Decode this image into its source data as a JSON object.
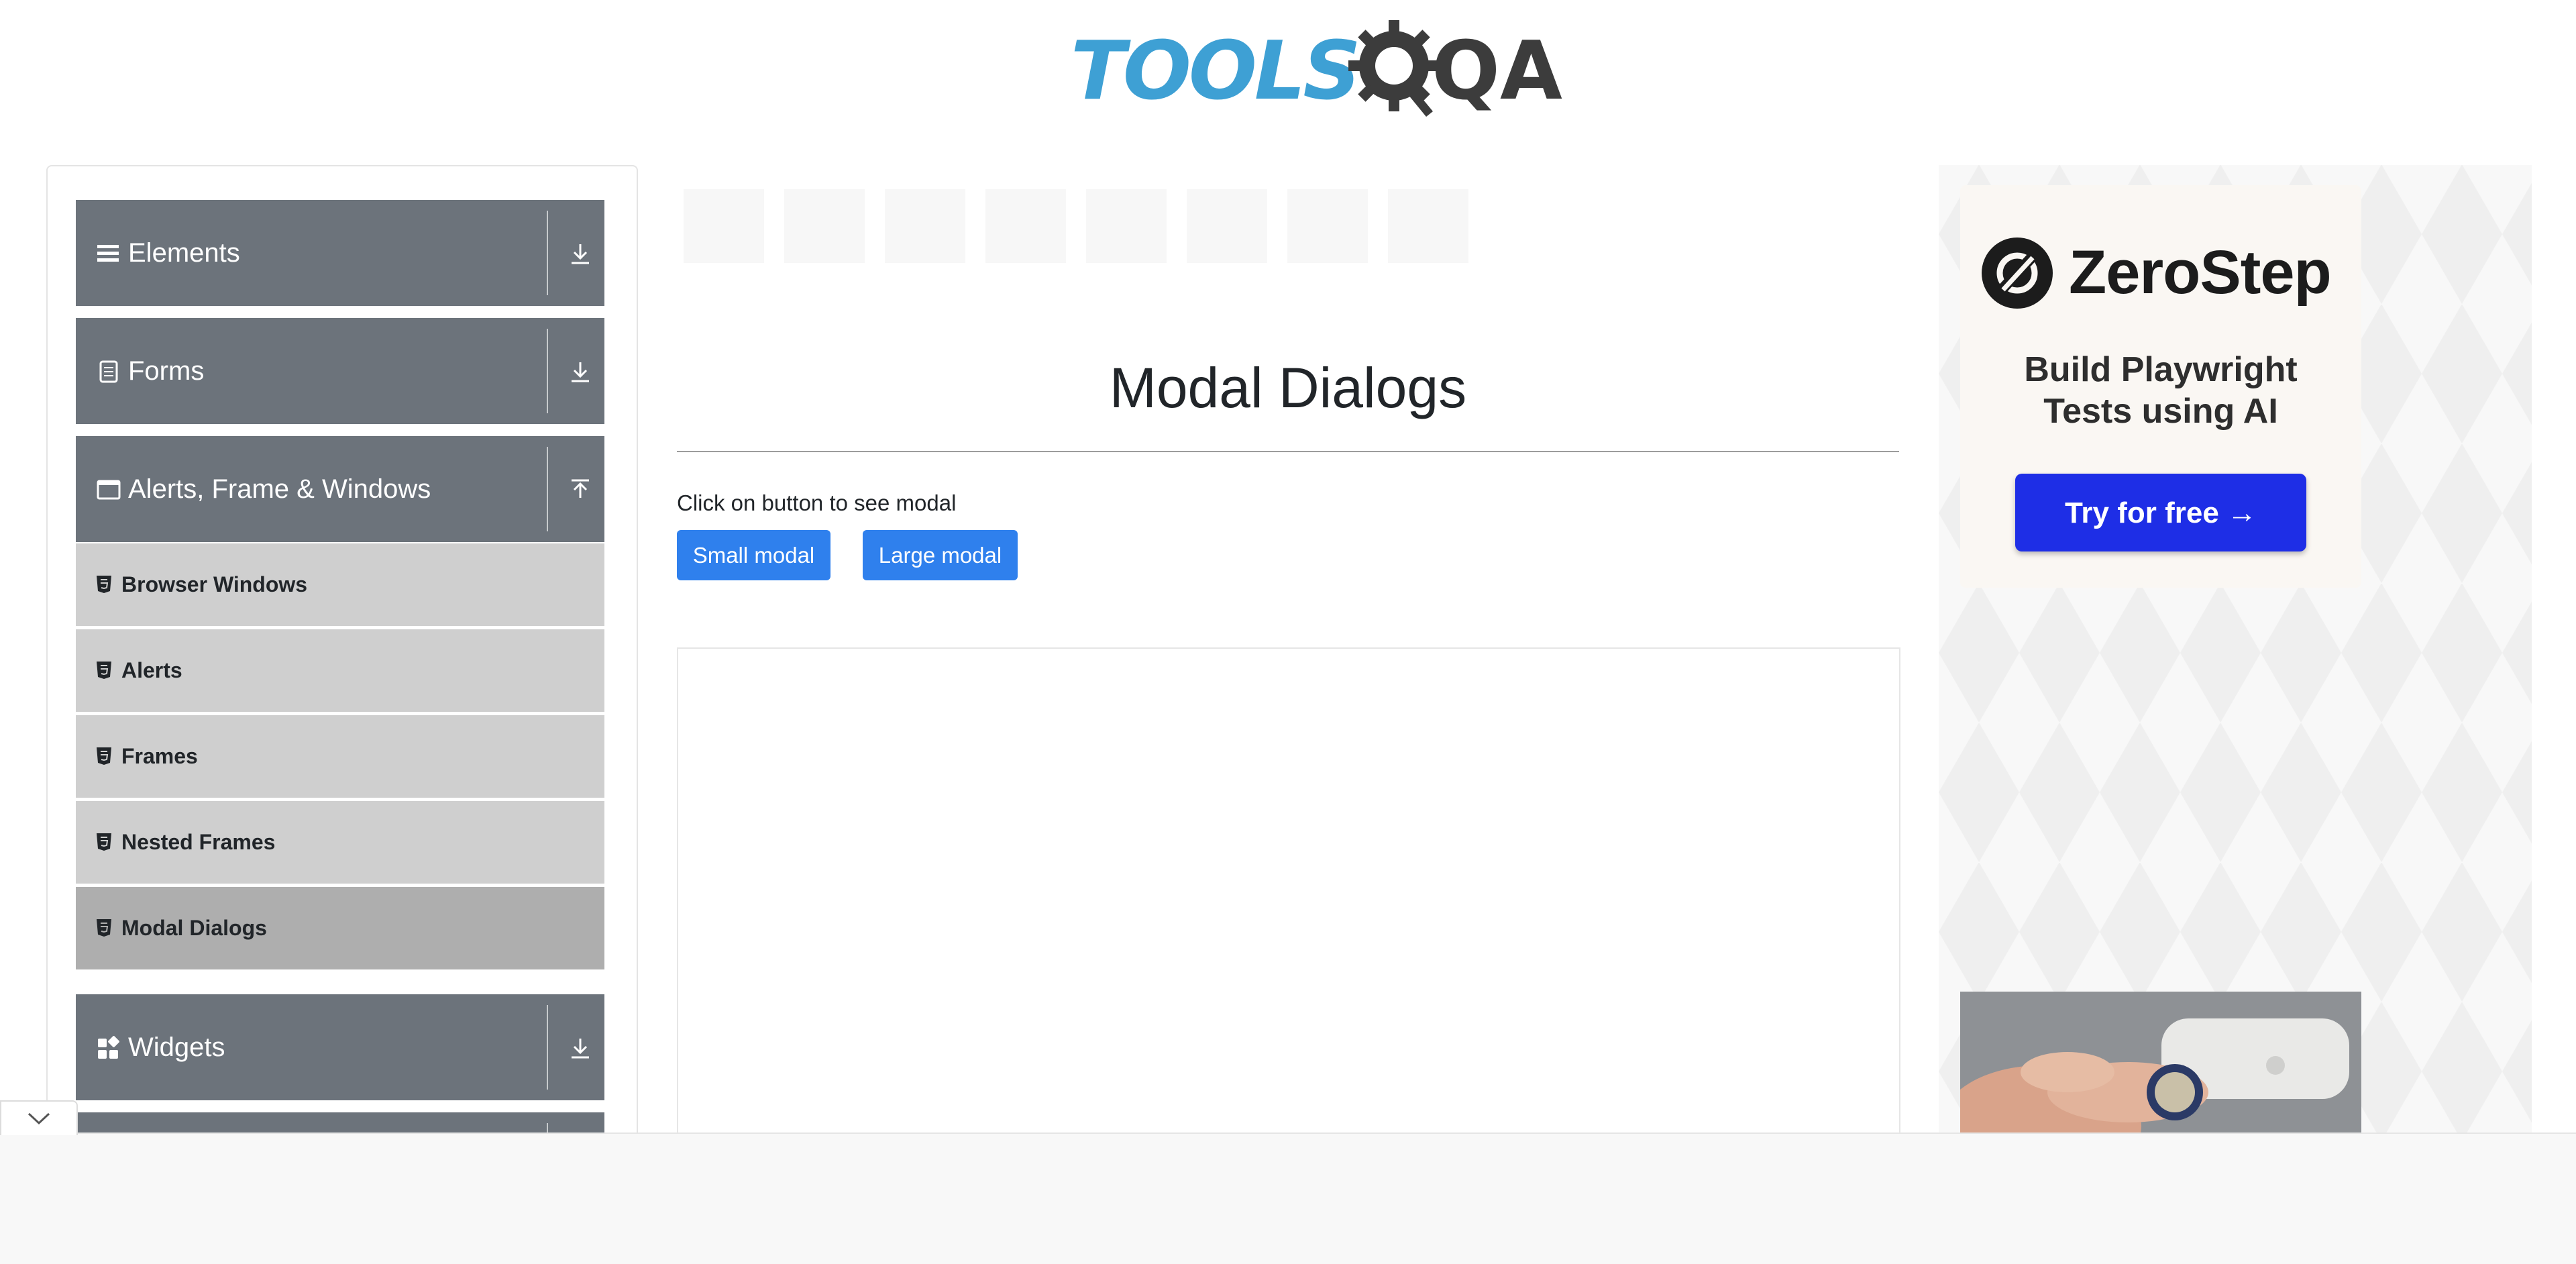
{
  "header": {
    "logo": {
      "text_primary": "TOOLS",
      "text_secondary": "QA",
      "gear_icon": "gear-magnifier-icon"
    }
  },
  "sidebar": {
    "groups": [
      {
        "label": "Elements",
        "icon": "hamburger-icon",
        "arrow": "download-icon"
      },
      {
        "label": "Forms",
        "icon": "document-icon",
        "arrow": "download-icon"
      },
      {
        "label": "Alerts, Frame & Windows",
        "icon": "window-icon",
        "arrow": "upload-icon"
      },
      {
        "label": "Widgets",
        "icon": "grid-icon",
        "arrow": "download-icon"
      }
    ],
    "items": [
      {
        "label": "Browser Windows",
        "icon": "html5-icon",
        "active": false
      },
      {
        "label": "Alerts",
        "icon": "html5-icon",
        "active": false
      },
      {
        "label": "Frames",
        "icon": "html5-icon",
        "active": false
      },
      {
        "label": "Nested Frames",
        "icon": "html5-icon",
        "active": false
      },
      {
        "label": "Modal Dialogs",
        "icon": "html5-icon",
        "active": true
      }
    ]
  },
  "main": {
    "title": "Modal Dialogs",
    "instruction": "Click on button to see modal",
    "buttons": {
      "small": "Small modal",
      "large": "Large modal"
    }
  },
  "ad": {
    "brand": "ZeroStep",
    "tagline_line1": "Build Playwright",
    "tagline_line2": "Tests using AI",
    "cta": "Try for free →"
  },
  "colors": {
    "accordion_header": "#6c737b",
    "menu_item": "#cfcfcf",
    "menu_item_active": "#aeaeae",
    "primary_button": "#2f80ed",
    "ad_cta": "#1e2ee6",
    "logo_blue": "#3ea0d4",
    "logo_dark": "#3c3c3c"
  }
}
